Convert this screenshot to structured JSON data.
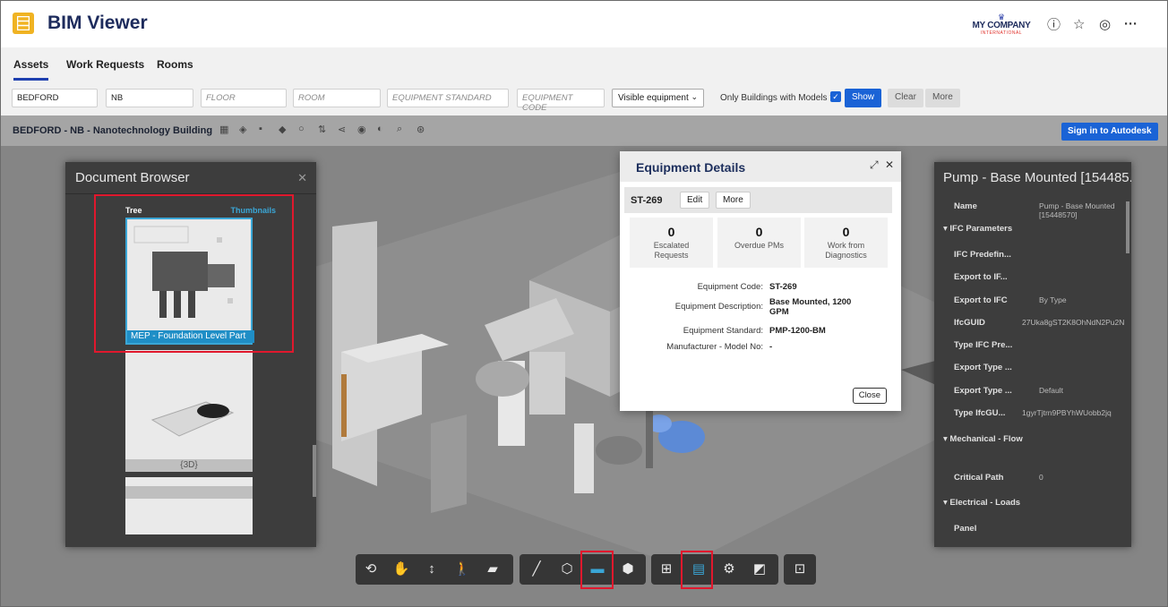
{
  "app": {
    "title": "BIM Viewer",
    "company": "MY COMPANY",
    "company_sub": "INTERNATIONAL"
  },
  "header_icons": [
    "help-icon",
    "star-settings-icon",
    "user-icon",
    "more-icon"
  ],
  "tabs": [
    {
      "label": "Assets",
      "active": true
    },
    {
      "label": "Work Requests",
      "active": false
    },
    {
      "label": "Rooms",
      "active": false
    }
  ],
  "filters": {
    "site": "BEDFORD",
    "building": "NB",
    "floor_placeholder": "FLOOR",
    "room_placeholder": "ROOM",
    "equipment_standard_placeholder": "EQUIPMENT STANDARD",
    "equipment_code_placeholder": "EQUIPMENT CODE",
    "visibility_select": "Visible equipment",
    "only_models_label": "Only Buildings with Models ?",
    "show_label": "Show",
    "clear_label": "Clear",
    "more_label": "More"
  },
  "viewer": {
    "title": "BEDFORD - NB - Nanotechnology Building",
    "signin_label": "Sign in to Autodesk",
    "toolbar_icons": [
      "layers-icon",
      "stack-icon",
      "grid-icon",
      "tag-icon",
      "refresh-icon",
      "sort-icon",
      "share-icon",
      "eye-icon",
      "eye-off-icon",
      "search-icon",
      "settings-icon"
    ]
  },
  "document_browser": {
    "title": "Document Browser",
    "tab_tree": "Tree",
    "tab_thumbnails": "Thumbnails",
    "thumbnails": [
      {
        "caption": "MEP - Foundation Level Part",
        "selected": true
      },
      {
        "caption": "{3D}",
        "selected": false
      },
      {
        "caption": "",
        "selected": false
      }
    ]
  },
  "equipment_details": {
    "title": "Equipment Details",
    "equipment_id": "ST-269",
    "edit_label": "Edit",
    "more_label": "More",
    "stats": [
      {
        "value": "0",
        "label": "Escalated Requests"
      },
      {
        "value": "0",
        "label": "Overdue PMs"
      },
      {
        "value": "0",
        "label": "Work from Diagnostics"
      }
    ],
    "fields": [
      {
        "key": "Equipment Code:",
        "value": "ST-269"
      },
      {
        "key": "Equipment Description:",
        "value": "Base Mounted, 1200 GPM"
      },
      {
        "key": "Equipment Standard:",
        "value": "PMP-1200-BM"
      },
      {
        "key": "Manufacturer - Model No:",
        "value": "-"
      }
    ],
    "close_label": "Close"
  },
  "properties": {
    "title": "Pump - Base Mounted [154485...",
    "rows": [
      {
        "key": "Name",
        "value": "Pump - Base Mounted [15448570]",
        "group": false
      },
      {
        "key": "IFC Parameters",
        "value": "",
        "group": true
      },
      {
        "key": "IFC Predefin...",
        "value": "",
        "group": false
      },
      {
        "key": "Export to IF...",
        "value": "",
        "group": false
      },
      {
        "key": "Export to IFC",
        "value": "By Type",
        "group": false
      },
      {
        "key": "IfcGUID",
        "value": "27Uka8gST2K8OhNdN2Pu2N",
        "group": false
      },
      {
        "key": "Type IFC Pre...",
        "value": "",
        "group": false
      },
      {
        "key": "Export Type ...",
        "value": "",
        "group": false
      },
      {
        "key": "Export Type ...",
        "value": "Default",
        "group": false
      },
      {
        "key": "Type IfcGU...",
        "value": "1gyrTjtrn9PBYhWUobb2jq",
        "group": false
      },
      {
        "key": "Mechanical - Flow",
        "value": "",
        "group": true
      },
      {
        "key": "Critical Path",
        "value": "0",
        "group": false
      },
      {
        "key": "Electrical - Loads",
        "value": "",
        "group": true
      },
      {
        "key": "Panel",
        "value": "",
        "group": false
      }
    ]
  },
  "bottom_toolbar": {
    "groups": [
      [
        "orbit-icon",
        "pan-icon",
        "dolly-icon",
        "walk-icon",
        "camera-icon"
      ],
      [
        "measure-icon",
        "section-icon",
        "document-browser-icon",
        "model-browser-icon"
      ],
      [
        "structure-icon",
        "properties-icon",
        "settings-icon",
        "fullscreen-icon"
      ],
      [
        "bim-info-icon"
      ]
    ]
  },
  "colors": {
    "accent": "#1a63d6",
    "highlight": "#e0182d",
    "selected": "#3aa6d6"
  }
}
